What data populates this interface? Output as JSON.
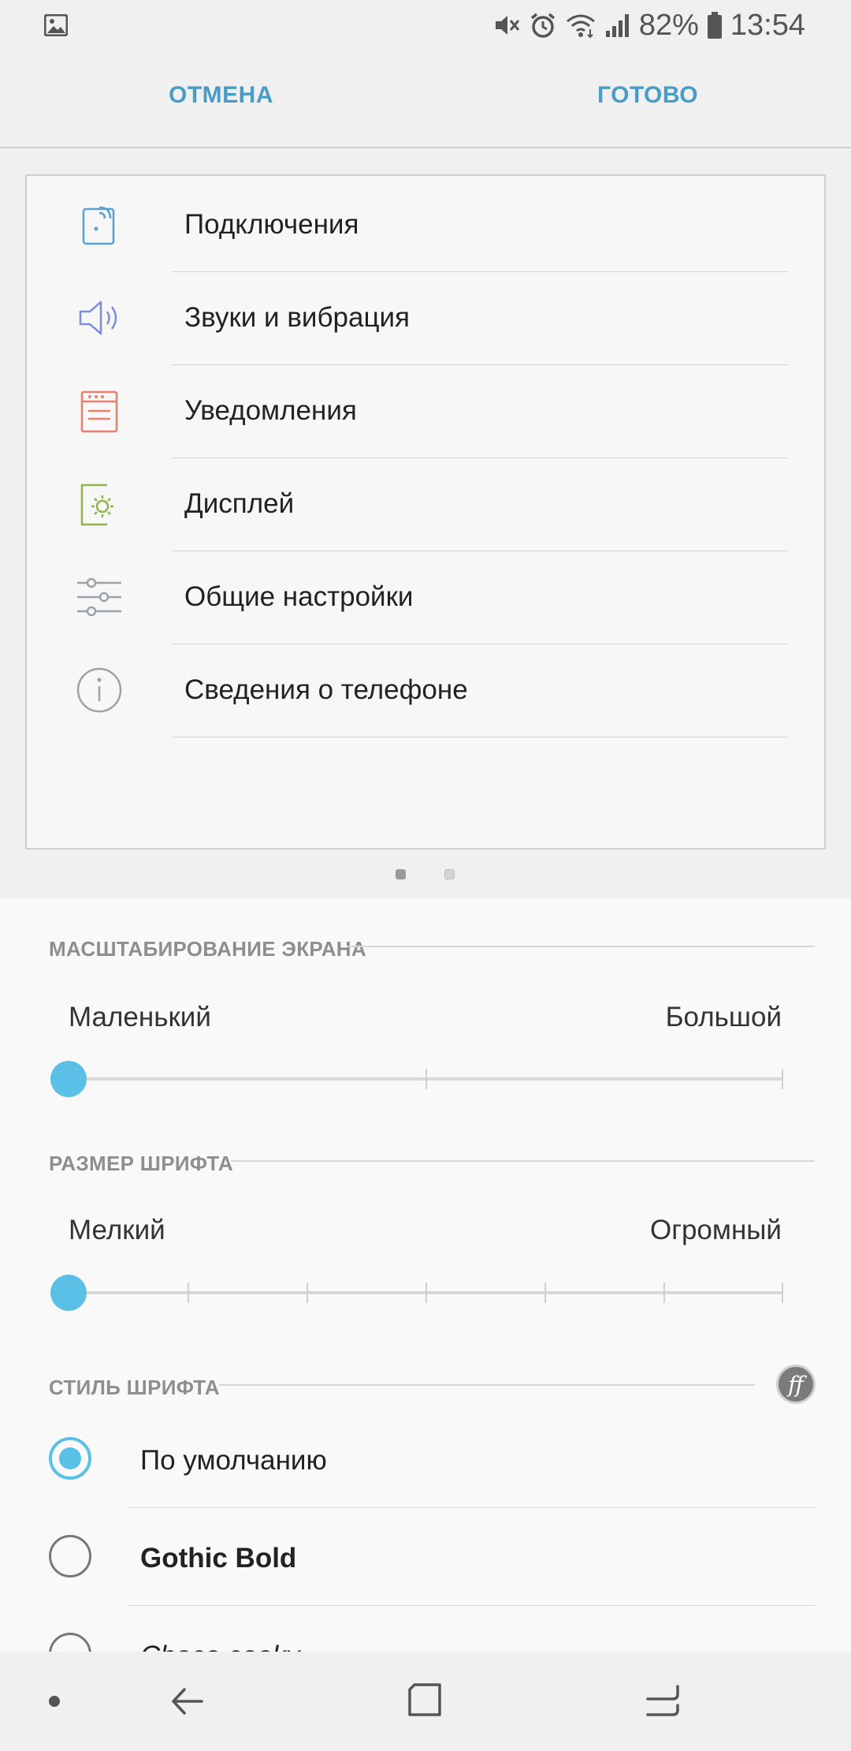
{
  "status_bar": {
    "battery": "82%",
    "time": "13:54"
  },
  "action_bar": {
    "cancel_label": "ОТМЕНА",
    "done_label": "ГОТОВО"
  },
  "preview": {
    "items": [
      {
        "label": "Подключения",
        "icon": "connections-icon",
        "color": "#5aa0d0"
      },
      {
        "label": "Звуки и вибрация",
        "icon": "speaker-icon",
        "color": "#7b8fd8"
      },
      {
        "label": "Уведомления",
        "icon": "notifications-icon",
        "color": "#e8806e"
      },
      {
        "label": "Дисплей",
        "icon": "display-icon",
        "color": "#8fb44a"
      },
      {
        "label": "Общие настройки",
        "icon": "sliders-icon",
        "color": "#9aa3a8"
      },
      {
        "label": "Сведения о телефоне",
        "icon": "info-icon",
        "color": "#9aa3a8"
      }
    ],
    "page_count": 2,
    "current_page": 1
  },
  "zoom": {
    "heading": "МАСШТАБИРОВАНИЕ ЭКРАНА",
    "min_label": "Маленький",
    "max_label": "Большой",
    "steps": 3,
    "value_index": 0
  },
  "font_size": {
    "heading": "РАЗМЕР ШРИФТА",
    "min_label": "Мелкий",
    "max_label": "Огромный",
    "steps": 7,
    "value_index": 0
  },
  "font_style": {
    "heading": "СТИЛЬ ШРИФТА",
    "options": [
      {
        "label": "По умолчанию",
        "selected": true
      },
      {
        "label": "Gothic Bold",
        "selected": false
      },
      {
        "label": "Choco cooky",
        "selected": false
      }
    ]
  },
  "colors": {
    "accent": "#5ac0e6",
    "action_text": "#4a9cc6"
  }
}
